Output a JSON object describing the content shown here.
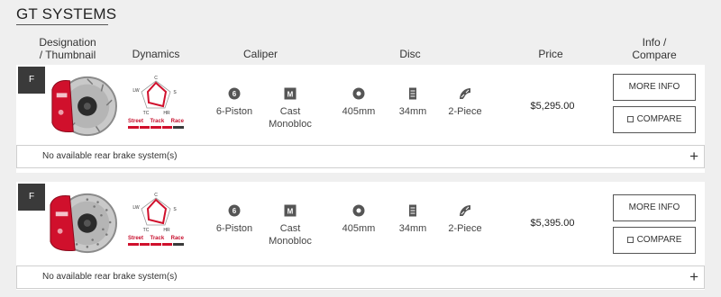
{
  "section": {
    "title": "GT SYSTEMS"
  },
  "headers": {
    "designation": "Designation",
    "thumbnail": "/ Thumbnail",
    "dynamics": "Dynamics",
    "caliper": "Caliper",
    "disc": "Disc",
    "price": "Price",
    "info": "Info /",
    "compare": "Compare"
  },
  "dynamics_labels": {
    "c": "C",
    "lw": "LW",
    "s": "S",
    "tc": "TC",
    "hr": "HR",
    "street": "Street",
    "track": "Track",
    "race": "Race"
  },
  "products": [
    {
      "badge": "F",
      "caliper_pistons": "6-Piston",
      "caliper_type_line1": "Cast",
      "caliper_type_line2": "Monobloc",
      "disc_diameter": "405mm",
      "disc_thickness": "34mm",
      "disc_type": "2-Piece",
      "price": "$5,295.00",
      "more_info_label": "MORE INFO",
      "compare_label": "COMPARE",
      "rear_text": "No available rear brake system(s)",
      "disc_style": "slotted"
    },
    {
      "badge": "F",
      "caliper_pistons": "6-Piston",
      "caliper_type_line1": "Cast",
      "caliper_type_line2": "Monobloc",
      "disc_diameter": "405mm",
      "disc_thickness": "34mm",
      "disc_type": "2-Piece",
      "price": "$5,395.00",
      "more_info_label": "MORE INFO",
      "compare_label": "COMPARE",
      "rear_text": "No available rear brake system(s)",
      "disc_style": "drilled"
    }
  ],
  "colors": {
    "accent_red": "#d0102c",
    "badge_dark": "#3a3a3a",
    "track_dark": "#3a3a3a"
  },
  "icons": [
    "piston-count-icon",
    "monobloc-icon",
    "disc-diameter-icon",
    "disc-thickness-icon",
    "two-piece-icon",
    "expand-plus-icon",
    "compare-checkbox-icon"
  ]
}
